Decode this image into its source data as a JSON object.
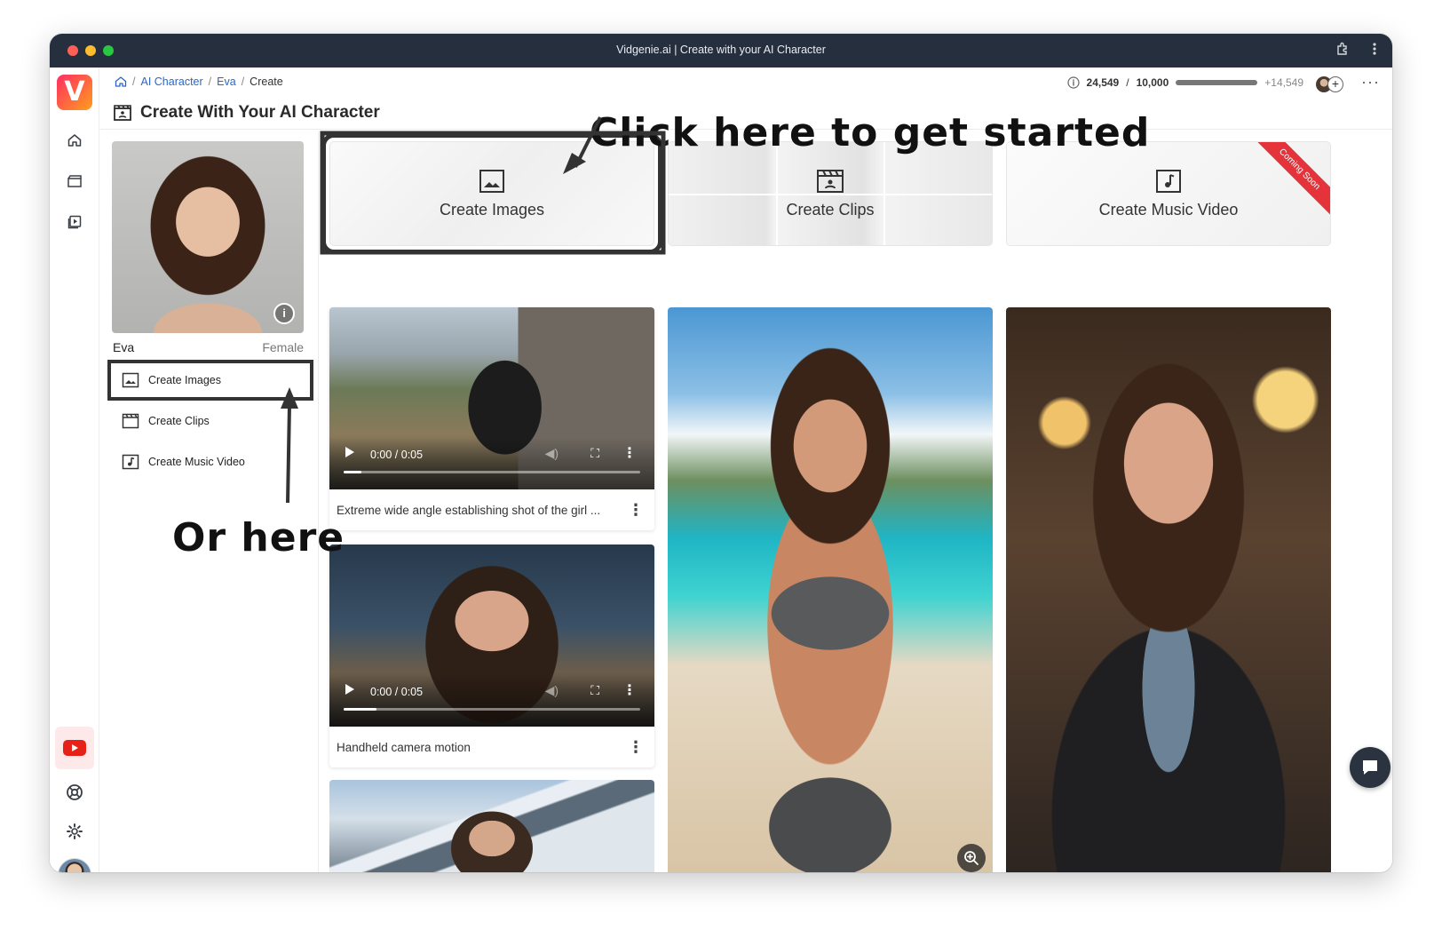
{
  "window": {
    "title": "Vidgenie.ai | Create with your AI Character"
  },
  "rail": {
    "logo_letter": "V"
  },
  "breadcrumb": {
    "root_icon": "home-icon",
    "items": [
      "AI Character",
      "Eva",
      "Create"
    ],
    "separator": "/"
  },
  "page": {
    "title": "Create With Your AI Character"
  },
  "credits": {
    "used": "24,549",
    "total": "10,000",
    "separator": "/",
    "extra": "+14,549"
  },
  "character": {
    "name": "Eva",
    "gender": "Female"
  },
  "menu": {
    "items": [
      "Create Images",
      "Create Clips",
      "Create Music Video"
    ]
  },
  "tiles": {
    "images": "Create Images",
    "clips": "Create Clips",
    "music": "Create Music Video",
    "ribbon": "Coming Soon"
  },
  "annotations": {
    "top": "Click here to get started",
    "side": "Or here"
  },
  "videos": [
    {
      "time": "0:00 / 0:05",
      "progress": 0.06,
      "caption": "Extreme wide angle establishing shot of the girl ..."
    },
    {
      "time": "0:00 / 0:05",
      "progress": 0.11,
      "caption": "Handheld camera motion"
    }
  ],
  "colors": {
    "titlebar": "#262f3d",
    "accent_link": "#2a66c9",
    "ribbon": "#e5333b"
  }
}
